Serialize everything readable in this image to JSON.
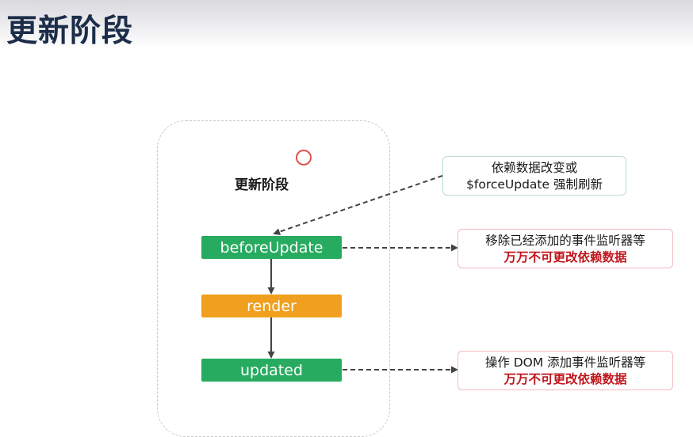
{
  "page": {
    "title": "更新阶段"
  },
  "diagram": {
    "frame_title": "更新阶段",
    "stages": {
      "before_update": "beforeUpdate",
      "render": "render",
      "updated": "updated"
    },
    "notes": {
      "trigger": {
        "line1": "依赖数据改变或",
        "line2": "$forceUpdate 强制刷新"
      },
      "before_update": {
        "line1": "移除已经添加的事件监听器等",
        "line2": "万万不可更改依赖数据"
      },
      "updated": {
        "line1": "操作 DOM 添加事件监听器等",
        "line2": "万万不可更改依赖数据"
      }
    }
  },
  "colors": {
    "stage_green": "#27ab60",
    "stage_orange": "#f0a01e",
    "warning_text": "#c0161c",
    "title_text": "#1c2d4a"
  }
}
